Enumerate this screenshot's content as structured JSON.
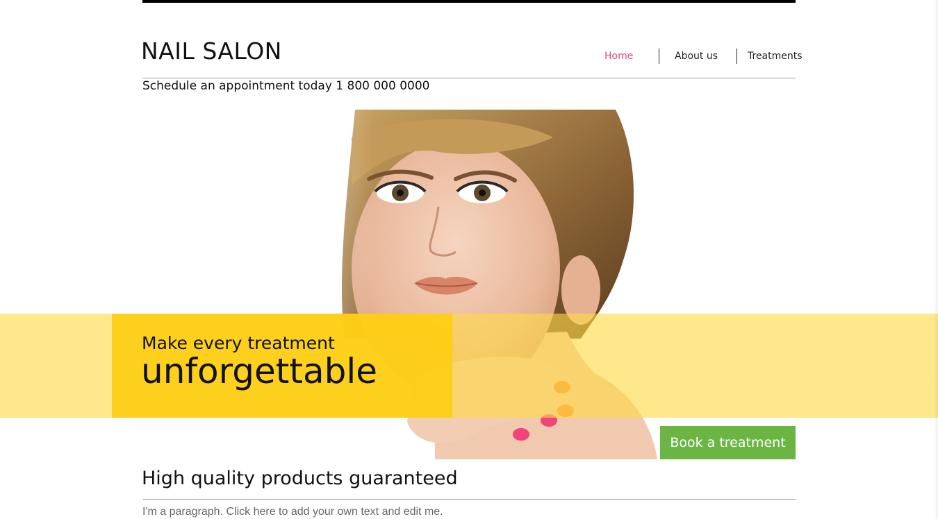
{
  "header": {
    "logo_text": "NAIL SALON",
    "schedule_text": "Schedule an appointment today  1 800 000 0000"
  },
  "nav": {
    "items": [
      {
        "label": "Home",
        "active": true
      },
      {
        "label": "About us",
        "active": false
      },
      {
        "label": "Treatments",
        "active": false
      }
    ],
    "active_color": "#e8457f"
  },
  "hero": {
    "tagline_small": "Make every treatment",
    "tagline_big": "unforgettable",
    "band_color": "#fdcd14",
    "band_light_color": "#ffe58a"
  },
  "cta": {
    "label": "Book a treatment",
    "color": "#6ab544"
  },
  "section": {
    "title": "High quality products guaranteed",
    "paragraph": "I'm a paragraph. Click here to add your own text and edit me."
  }
}
